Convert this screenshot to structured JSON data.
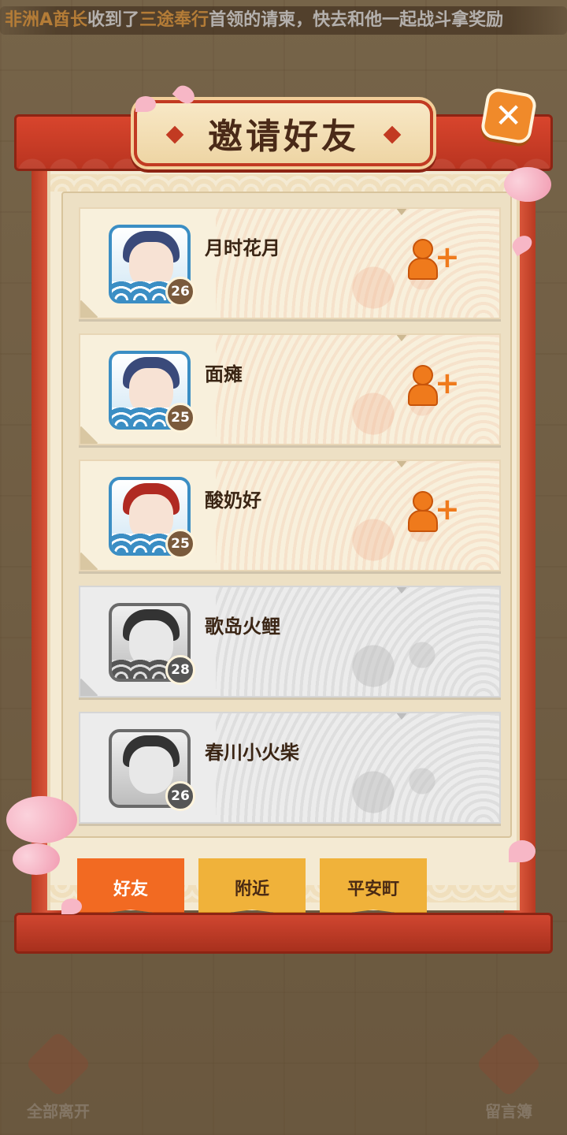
{
  "marquee": {
    "prefix": "非洲A酋长",
    "mid1": "收到了",
    "boss": "三途奉行",
    "mid2": "首领的请柬，快去和他一起战斗拿奖励"
  },
  "dialog": {
    "title": "邀请好友",
    "close_symbol": "✕"
  },
  "friends": [
    {
      "name": "月时花月",
      "level": "26",
      "online": true,
      "hair": "navy"
    },
    {
      "name": "面瘫",
      "level": "25",
      "online": true,
      "hair": "navy"
    },
    {
      "name": "酸奶好",
      "level": "25",
      "online": true,
      "hair": "red"
    },
    {
      "name": "歌岛火鲤",
      "level": "28",
      "online": false,
      "hair": "dark"
    },
    {
      "name": "春川小火柴",
      "level": "26",
      "online": false,
      "hair": "dark"
    }
  ],
  "tabs": {
    "friends": "好友",
    "nearby": "附近",
    "town": "平安町",
    "active": "friends"
  },
  "background": {
    "leave_all": "全部离开",
    "guestbook": "留言簿"
  },
  "colors": {
    "accent": "#f26a22",
    "frame_red": "#c23a22",
    "tab_yellow": "#f0b23a"
  }
}
